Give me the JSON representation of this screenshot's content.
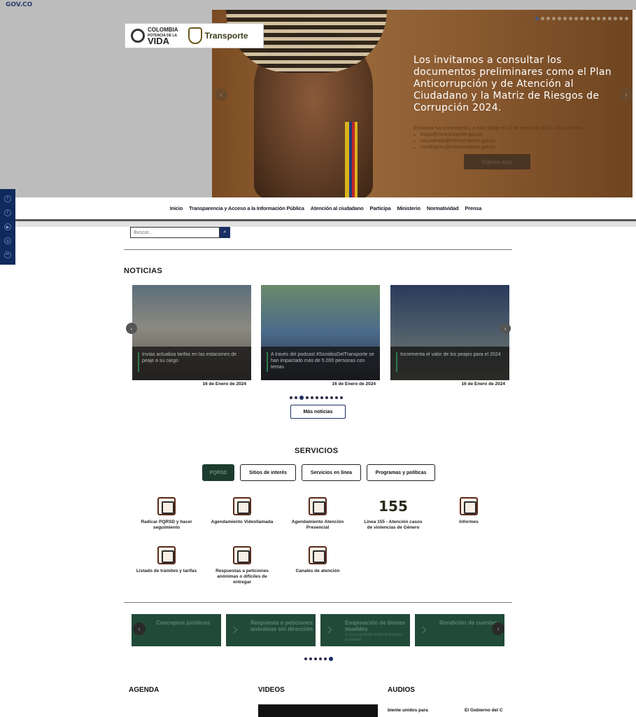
{
  "topbar": {
    "gov_logo": "GOV.CO"
  },
  "brand": {
    "colombia_line1": "COLOMBIA",
    "colombia_line2": "POTENCIA DE LA",
    "colombia_line3": "VIDA",
    "ministry": "Transporte"
  },
  "hero": {
    "title": "Los invitamos a consultar los documentos preliminares como el Plan Anticorrupción y de Atención al Ciudadano y la Matriz de Riesgos de Corrupción 2024.",
    "note": "Envíanos tus comentarios, a más tardar el 23 de enero de 2024, a los correos",
    "emails": [
      "lrojas@mintransporte.gov.co",
      "mcuadrado@mintransporte.gov.co",
      "mrodriguez@mintransporte.gov.co"
    ],
    "cta": "Ingresa aquí",
    "prev": "‹",
    "next": "›"
  },
  "nav": {
    "items": [
      "Inicio",
      "Transparencia y Acceso a la Información Pública",
      "Atención al ciudadano",
      "Participa",
      "Ministerio",
      "Normatividad",
      "Prensa"
    ]
  },
  "search": {
    "placeholder": "Buscar..."
  },
  "news": {
    "title": "NOTICIAS",
    "cards": [
      {
        "caption": "Invías actualiza tarifas en las estaciones de peaje a su cargo",
        "date": "16 de Enero de 2024"
      },
      {
        "caption": "A través del podcast #SonidosDelTransporte se han impactado más de 5.000 personas con temas",
        "date": "16 de Enero de 2024"
      },
      {
        "caption": "Incrementa el valor de los peajes para el 2024",
        "date": "16 de Enero de 2024"
      }
    ],
    "more": "Más noticias"
  },
  "services": {
    "title": "SERVICIOS",
    "tabs": [
      "PQRSD",
      "Sitios de interés",
      "Servicios en línea",
      "Programas y políticas"
    ],
    "items": [
      "Radicar PQRSD y hacer seguimiento",
      "Agendamiento Videollamada",
      "Agendamiento Atención Presencial",
      "Línea 155 - Atención casos de violencias de Género",
      "Informes",
      "Listado de trámites y tarifas",
      "Respuestas a peticiones anónimas o difíciles de entregar",
      "Canales de atención"
    ],
    "line155": "155"
  },
  "links": {
    "cards": [
      {
        "title": "Conceptos jurídicos",
        "sub": ""
      },
      {
        "title": "Respuesta a peticiones anónimas sin dirección",
        "sub": ""
      },
      {
        "title": "Enajenación de bienes muebles",
        "sub": "a título gratuito entre entidades estatales"
      },
      {
        "title": "Rendición de cuentas",
        "sub": ""
      }
    ]
  },
  "footer": {
    "agenda": "AGENDA",
    "videos": "VIDEOS",
    "audios": "AUDIOS",
    "audio1": "biente unidos para",
    "audio2": "El Gobierno del C"
  },
  "colors": {
    "accent_green": "#214a39",
    "nav_blue": "#1b2f63",
    "social_bar": "#0f2a5c"
  }
}
